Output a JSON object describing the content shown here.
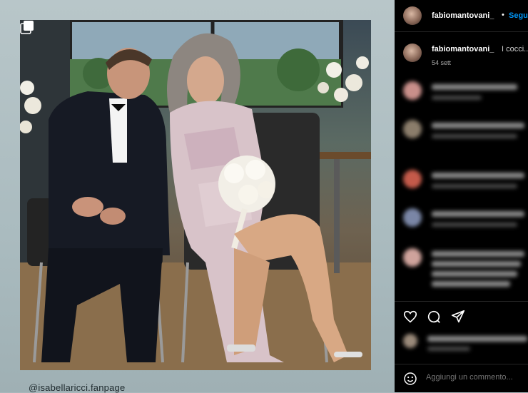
{
  "post": {
    "credit": "@isabellaricci.fanpage"
  },
  "sidebar": {
    "header": {
      "username": "fabiomantovani_",
      "separator": "•",
      "follow_label": "Segui"
    },
    "caption": {
      "username": "fabiomantovani_",
      "text": "I cocci...",
      "time": "54 sett"
    },
    "comment_placeholder": "Aggiungi un commento..."
  },
  "icons": {
    "multi": "multiple-photos-icon",
    "like": "heart-icon",
    "comment": "comment-bubble-icon",
    "share": "paper-plane-icon",
    "emoji": "emoji-icon"
  },
  "colors": {
    "accent": "#0095f6",
    "panel": "#000000",
    "secondary_text": "#a8a8a8"
  }
}
